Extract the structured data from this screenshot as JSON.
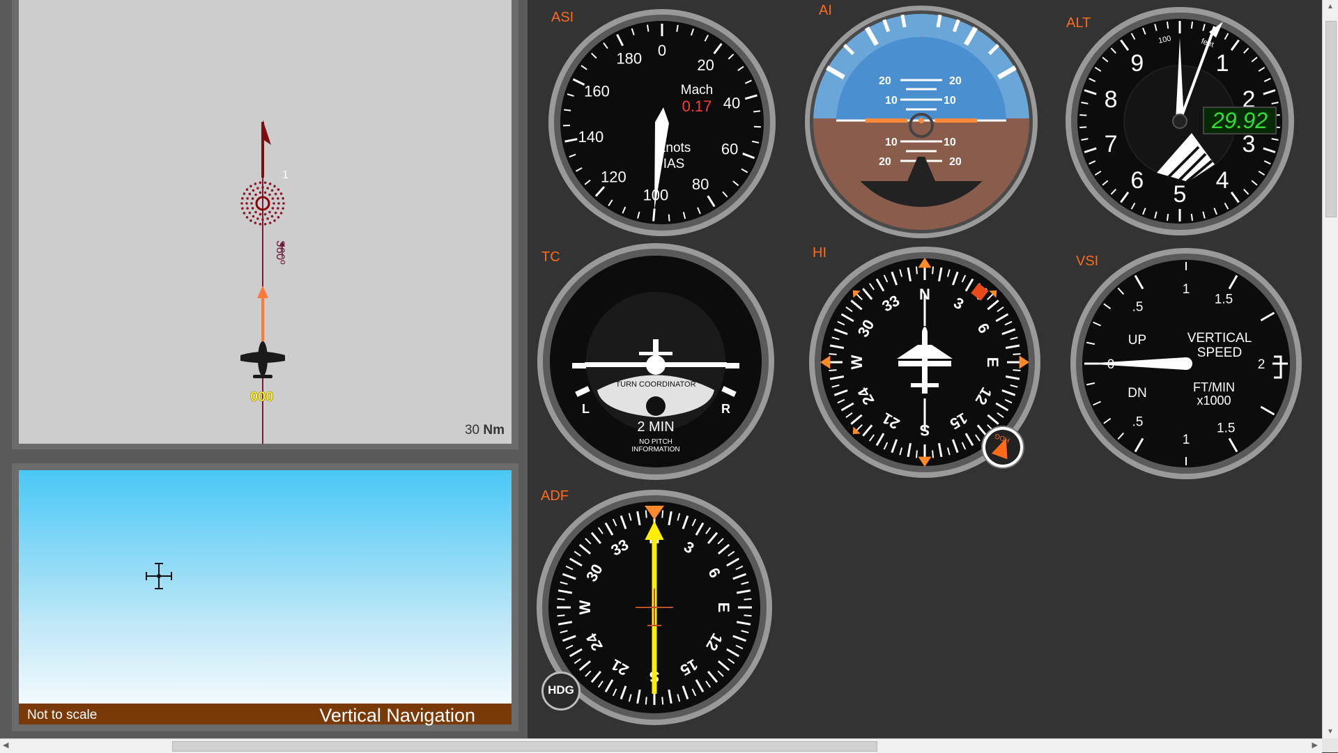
{
  "horizontal_nav": {
    "waypoint_number": "1",
    "course_label": "360º",
    "heading_readout": "000",
    "scale_value": "30",
    "scale_unit": "Nm"
  },
  "vertical_nav": {
    "note": "Not to scale",
    "title": "Vertical Navigation"
  },
  "gauges": {
    "asi": {
      "label": "ASI",
      "ticks": [
        "0",
        "20",
        "40",
        "60",
        "80",
        "100",
        "120",
        "140",
        "160",
        "180"
      ],
      "mach_label": "Mach",
      "mach_value": "0.17",
      "unit_line1": "Knots",
      "unit_line2": "IAS",
      "airspeed_knots": 100
    },
    "ai": {
      "label": "AI",
      "pitch_marks": [
        "20",
        "10",
        "10",
        "20"
      ],
      "pitch_deg": 0,
      "bank_deg": 0
    },
    "alt": {
      "label": "ALT",
      "digits": [
        "0",
        "1",
        "2",
        "3",
        "4",
        "5",
        "6",
        "7",
        "8",
        "9"
      ],
      "label_100": "100",
      "label_feet": "feet",
      "baro_setting": "29.92"
    },
    "tc": {
      "label": "TC",
      "title": "TURN COORDINATOR",
      "left": "L",
      "right": "R",
      "time": "2 MIN",
      "note_line1": "NO PITCH",
      "note_line2": "INFORMATION"
    },
    "hi": {
      "label": "HI",
      "cardinals": [
        "N",
        "E",
        "S",
        "W"
      ],
      "numbers": [
        "3",
        "6",
        "12",
        "15",
        "21",
        "24",
        "30",
        "33"
      ],
      "heading_deg": 0,
      "hdg_knob": "HDG"
    },
    "vsi": {
      "label": "VSI",
      "up": "UP",
      "dn": "DN",
      "title_line1": "VERTICAL",
      "title_line2": "SPEED",
      "unit_line1": "FT/MIN",
      "unit_line2": "x1000",
      "marks": [
        ".5",
        "1",
        "1.5",
        "2",
        ".5",
        "1",
        "1.5",
        "0"
      ],
      "vertical_speed_fpm": 0
    },
    "adf": {
      "label": "ADF",
      "cardinals": [
        "N",
        "E",
        "S",
        "W"
      ],
      "numbers": [
        "3",
        "6",
        "12",
        "15",
        "21",
        "24",
        "30",
        "33"
      ],
      "bearing_deg": 0,
      "hdg_button": "HDG"
    }
  },
  "colors": {
    "accent": "#ff6b1a",
    "sky": "#4a8fd0",
    "ground": "#8a5c4c",
    "baro_green": "#33dd33",
    "mach_red": "#ff3b3b",
    "adf_needle": "#ffee00"
  }
}
